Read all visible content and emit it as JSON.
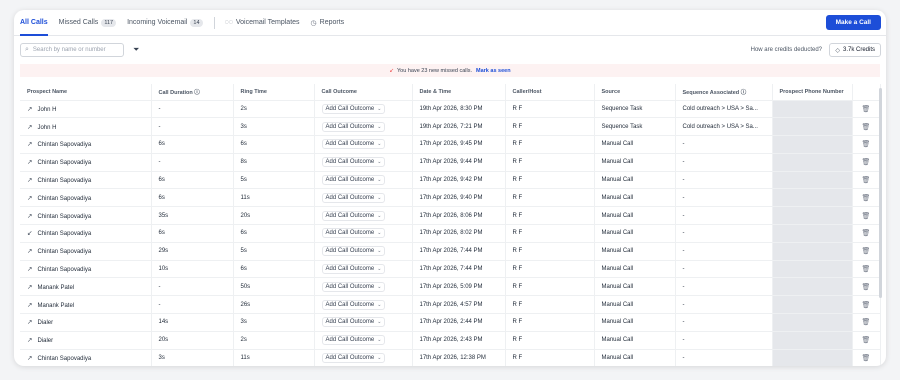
{
  "tabs": [
    {
      "label": "All Calls"
    },
    {
      "label": "Missed Calls",
      "count": "117"
    },
    {
      "label": "Incoming Voicemail",
      "count": "14"
    },
    {
      "label": "Voicemail Templates"
    },
    {
      "label": "Reports"
    }
  ],
  "make_call_label": "Make a Call",
  "search": {
    "placeholder": "Search by name or number"
  },
  "credits_question": "How are credits deducted?",
  "credits_value": "3.7k Credits",
  "notice": {
    "text": "You have 23 new missed calls.",
    "link": "Mark as seen"
  },
  "columns": [
    "Prospect Name",
    "Call Duration",
    "Ring Time",
    "Call Outcome",
    "Date & Time",
    "Caller/Host",
    "Source",
    "Sequence Associated",
    "Prospect Phone Number",
    ""
  ],
  "outcome_label": "Add Call Outcome",
  "rows": [
    {
      "name": "John H",
      "duration": "-",
      "ring": "2s",
      "date": "19th Apr 2026, 8:30 PM",
      "caller": "R F",
      "source": "Sequence Task",
      "sequence": "Cold outreach > USA > Sa..."
    },
    {
      "name": "John H",
      "duration": "-",
      "ring": "3s",
      "date": "19th Apr 2026, 7:21 PM",
      "caller": "R F",
      "source": "Sequence Task",
      "sequence": "Cold outreach > USA > Sa..."
    },
    {
      "name": "Chintan Sapovadiya",
      "duration": "6s",
      "ring": "6s",
      "date": "17th Apr 2026, 9:45 PM",
      "caller": "R F",
      "source": "Manual Call",
      "sequence": "-"
    },
    {
      "name": "Chintan Sapovadiya",
      "duration": "-",
      "ring": "8s",
      "date": "17th Apr 2026, 9:44 PM",
      "caller": "R F",
      "source": "Manual Call",
      "sequence": "-"
    },
    {
      "name": "Chintan Sapovadiya",
      "duration": "6s",
      "ring": "5s",
      "date": "17th Apr 2026, 9:42 PM",
      "caller": "R F",
      "source": "Manual Call",
      "sequence": "-"
    },
    {
      "name": "Chintan Sapovadiya",
      "duration": "6s",
      "ring": "11s",
      "date": "17th Apr 2026, 9:40 PM",
      "caller": "R F",
      "source": "Manual Call",
      "sequence": "-"
    },
    {
      "name": "Chintan Sapovadiya",
      "duration": "35s",
      "ring": "20s",
      "date": "17th Apr 2026, 8:06 PM",
      "caller": "R F",
      "source": "Manual Call",
      "sequence": "-"
    },
    {
      "name": "Chintan Sapovadiya",
      "duration": "6s",
      "ring": "6s",
      "date": "17th Apr 2026, 8:02 PM",
      "caller": "R F",
      "source": "Manual Call",
      "sequence": "-",
      "incoming": true
    },
    {
      "name": "Chintan Sapovadiya",
      "duration": "29s",
      "ring": "5s",
      "date": "17th Apr 2026, 7:44 PM",
      "caller": "R F",
      "source": "Manual Call",
      "sequence": "-"
    },
    {
      "name": "Chintan Sapovadiya",
      "duration": "10s",
      "ring": "6s",
      "date": "17th Apr 2026, 7:44 PM",
      "caller": "R F",
      "source": "Manual Call",
      "sequence": "-"
    },
    {
      "name": "Manank Patel",
      "duration": "-",
      "ring": "50s",
      "date": "17th Apr 2026, 5:09 PM",
      "caller": "R F",
      "source": "Manual Call",
      "sequence": "-"
    },
    {
      "name": "Manank Patel",
      "duration": "-",
      "ring": "26s",
      "date": "17th Apr 2026, 4:57 PM",
      "caller": "R F",
      "source": "Manual Call",
      "sequence": "-"
    },
    {
      "name": "Dialer",
      "duration": "14s",
      "ring": "3s",
      "date": "17th Apr 2026, 2:44 PM",
      "caller": "R F",
      "source": "Manual Call",
      "sequence": "-"
    },
    {
      "name": "Dialer",
      "duration": "20s",
      "ring": "2s",
      "date": "17th Apr 2026, 2:43 PM",
      "caller": "R F",
      "source": "Manual Call",
      "sequence": "-"
    },
    {
      "name": "Chintan Sapovadiya",
      "duration": "3s",
      "ring": "11s",
      "date": "17th Apr 2026, 12:38 PM",
      "caller": "R F",
      "source": "Manual Call",
      "sequence": "-"
    }
  ]
}
